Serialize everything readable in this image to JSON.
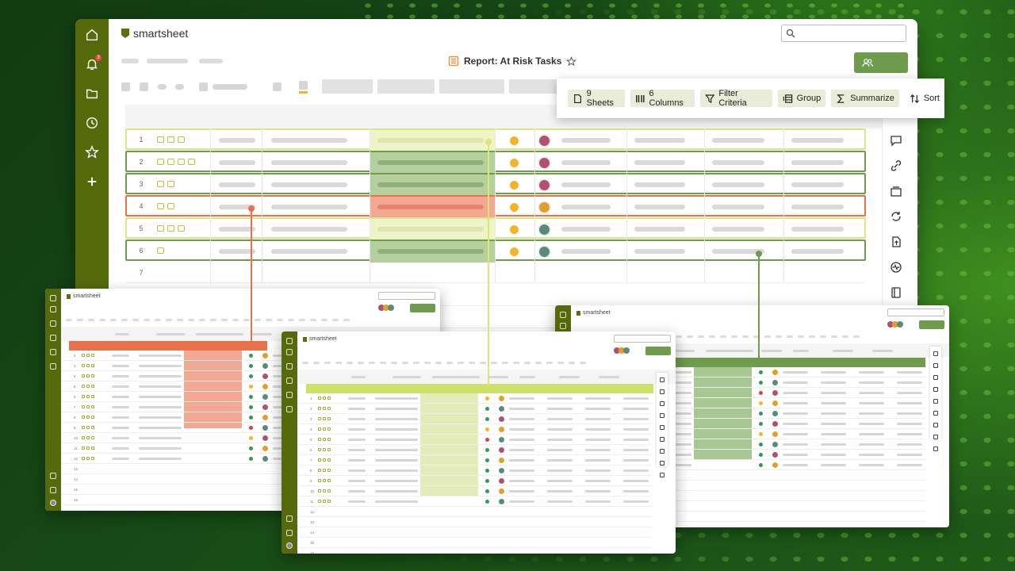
{
  "app": {
    "brand": "smartsheet"
  },
  "header": {
    "report_title": "Report: At Risk Tasks",
    "notification_count": "3",
    "search_placeholder": ""
  },
  "toolbar": {
    "sheets": "9 Sheets",
    "columns": "6 Columns",
    "filter": "Filter Criteria",
    "group": "Group",
    "summarize": "Summarize",
    "sort": "Sort"
  },
  "grid": {
    "rows": [
      {
        "num": "1",
        "status": "warn",
        "row_color": "light-yellow",
        "icons": 3
      },
      {
        "num": "2",
        "status": "warn",
        "row_color": "green",
        "icons": 4
      },
      {
        "num": "3",
        "status": "warn",
        "row_color": "green",
        "icons": 2
      },
      {
        "num": "4",
        "status": "warn",
        "row_color": "red",
        "icons": 2
      },
      {
        "num": "5",
        "status": "warn",
        "row_color": "light-yellow",
        "icons": 3
      },
      {
        "num": "6",
        "status": "warn",
        "row_color": "green",
        "icons": 1
      },
      {
        "num": "7",
        "status": "none",
        "row_color": "none",
        "icons": 0
      }
    ]
  },
  "mini_windows": [
    {
      "brand": "smartsheet",
      "accent": "#e8704a",
      "rows": [
        "2",
        "3",
        "4",
        "5",
        "6",
        "7",
        "8",
        "9",
        "10",
        "11",
        "12",
        "13",
        "14",
        "15",
        "16"
      ]
    },
    {
      "brand": "smartsheet",
      "accent": "#cfe06a",
      "rows": [
        "1",
        "2",
        "3",
        "4",
        "5",
        "6",
        "7",
        "8",
        "9",
        "10",
        "11",
        "12",
        "13",
        "14",
        "15",
        "16"
      ]
    },
    {
      "brand": "smartsheet",
      "accent": "#6e9b4c",
      "rows": []
    }
  ],
  "colors": {
    "sidebar": "#566a0c",
    "accent_green": "#6e9b4c",
    "accent_red": "#e8704a",
    "accent_yellow": "#e3ec9f",
    "status_yellow": "#f2b52a"
  }
}
